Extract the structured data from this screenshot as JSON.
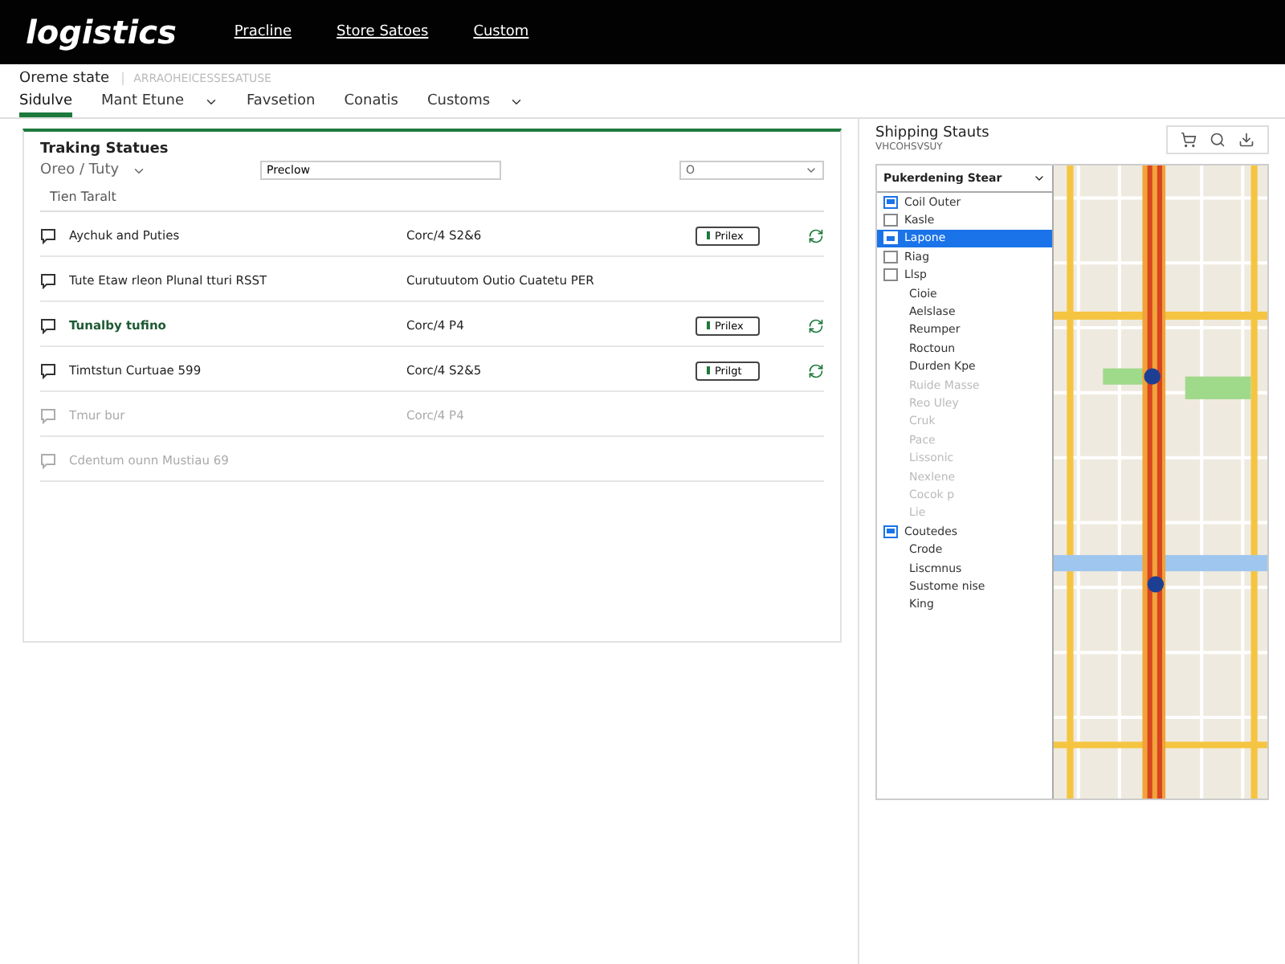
{
  "header": {
    "logo": "logistics",
    "nav": [
      "Pracline",
      "Store Satoes",
      "Custom"
    ]
  },
  "breadcrumb": {
    "title": "Oreme state",
    "code": "ARRAOHEICESSESATUSE"
  },
  "tabs": [
    {
      "label": "Sidulve",
      "selected": true,
      "dropdown": false
    },
    {
      "label": "Mant Etune",
      "selected": false,
      "dropdown": true
    },
    {
      "label": "Favsetion",
      "selected": false,
      "dropdown": false
    },
    {
      "label": "Conatis",
      "selected": false,
      "dropdown": false
    },
    {
      "label": "Customs",
      "selected": false,
      "dropdown": true
    }
  ],
  "tracking": {
    "title": "Traking Statues",
    "filter": "Oreo / Tuty",
    "search": {
      "value": "Preclow"
    },
    "select": {
      "value": "O"
    },
    "subtitle": "Tien Taralt",
    "rows": [
      {
        "name": "Aychuk and Puties",
        "code": "Corc/4 S2&6",
        "action": "Prilex",
        "disabled": false,
        "highlight": false
      },
      {
        "name": "Tute Etaw rleon Plunal tturi RSST",
        "code": "Curutuutom Outio Cuatetu PER",
        "disabled": false,
        "highlight": false
      },
      {
        "name": "Tunalby tufino",
        "code": "Corc/4 P4",
        "action": "Prilex",
        "disabled": false,
        "highlight": true
      },
      {
        "name": "Timtstun Curtuae 599",
        "code": "Corc/4 S2&5",
        "action": "Prilgt",
        "disabled": false,
        "highlight": false
      },
      {
        "name": "Tmur bur",
        "code": "Corc/4 P4",
        "disabled": true,
        "highlight": false
      },
      {
        "name": "Cdentum ounn Mustiau 69",
        "disabled": true,
        "highlight": false
      }
    ]
  },
  "shipping": {
    "title": "Shipping Stauts",
    "subtitle": "VHCOHSVSUY",
    "dropdown": {
      "value": "Pukerdening Stear",
      "items": [
        {
          "label": "Coil Outer",
          "kind": "checkbox",
          "checked": true,
          "selected": false,
          "disabled": false
        },
        {
          "label": "Kasle",
          "kind": "checkbox",
          "checked": false,
          "selected": false,
          "disabled": false
        },
        {
          "label": "Lapone",
          "kind": "checkbox",
          "checked": true,
          "selected": true,
          "disabled": false
        },
        {
          "label": "Riag",
          "kind": "checkbox",
          "checked": false,
          "selected": false,
          "disabled": false
        },
        {
          "label": "Llsp",
          "kind": "checkbox",
          "checked": false,
          "selected": false,
          "disabled": false
        },
        {
          "label": "Cioie",
          "kind": "plain",
          "selected": false,
          "disabled": false
        },
        {
          "label": "Aelslase",
          "kind": "plain",
          "selected": false,
          "disabled": false
        },
        {
          "label": "Reumper",
          "kind": "plain",
          "selected": false,
          "disabled": false
        },
        {
          "label": "Roctoun",
          "kind": "plain",
          "selected": false,
          "disabled": false
        },
        {
          "label": "Durden Kpe",
          "kind": "plain",
          "selected": false,
          "disabled": false
        },
        {
          "label": "Ruide Masse",
          "kind": "plain",
          "selected": false,
          "disabled": true
        },
        {
          "label": "Reo Uley",
          "kind": "plain",
          "selected": false,
          "disabled": true
        },
        {
          "label": "Cruk",
          "kind": "plain",
          "selected": false,
          "disabled": true
        },
        {
          "label": "Pace",
          "kind": "plain",
          "selected": false,
          "disabled": true
        },
        {
          "label": "Lissonic",
          "kind": "plain",
          "selected": false,
          "disabled": true
        },
        {
          "label": "Nexlene",
          "kind": "plain",
          "selected": false,
          "disabled": true
        },
        {
          "label": "Cocok p",
          "kind": "plain",
          "selected": false,
          "disabled": true
        },
        {
          "label": "Lie",
          "kind": "plain",
          "selected": false,
          "disabled": true
        },
        {
          "label": "Coutedes",
          "kind": "checkbox",
          "checked": true,
          "selected": false,
          "disabled": false
        },
        {
          "label": "Crode",
          "kind": "plain",
          "selected": false,
          "disabled": false
        },
        {
          "label": "Liscmnus",
          "kind": "plain",
          "selected": false,
          "disabled": false
        },
        {
          "label": "Sustome nise",
          "kind": "plain",
          "selected": false,
          "disabled": false
        },
        {
          "label": "King",
          "kind": "plain",
          "selected": false,
          "disabled": false
        }
      ]
    }
  }
}
